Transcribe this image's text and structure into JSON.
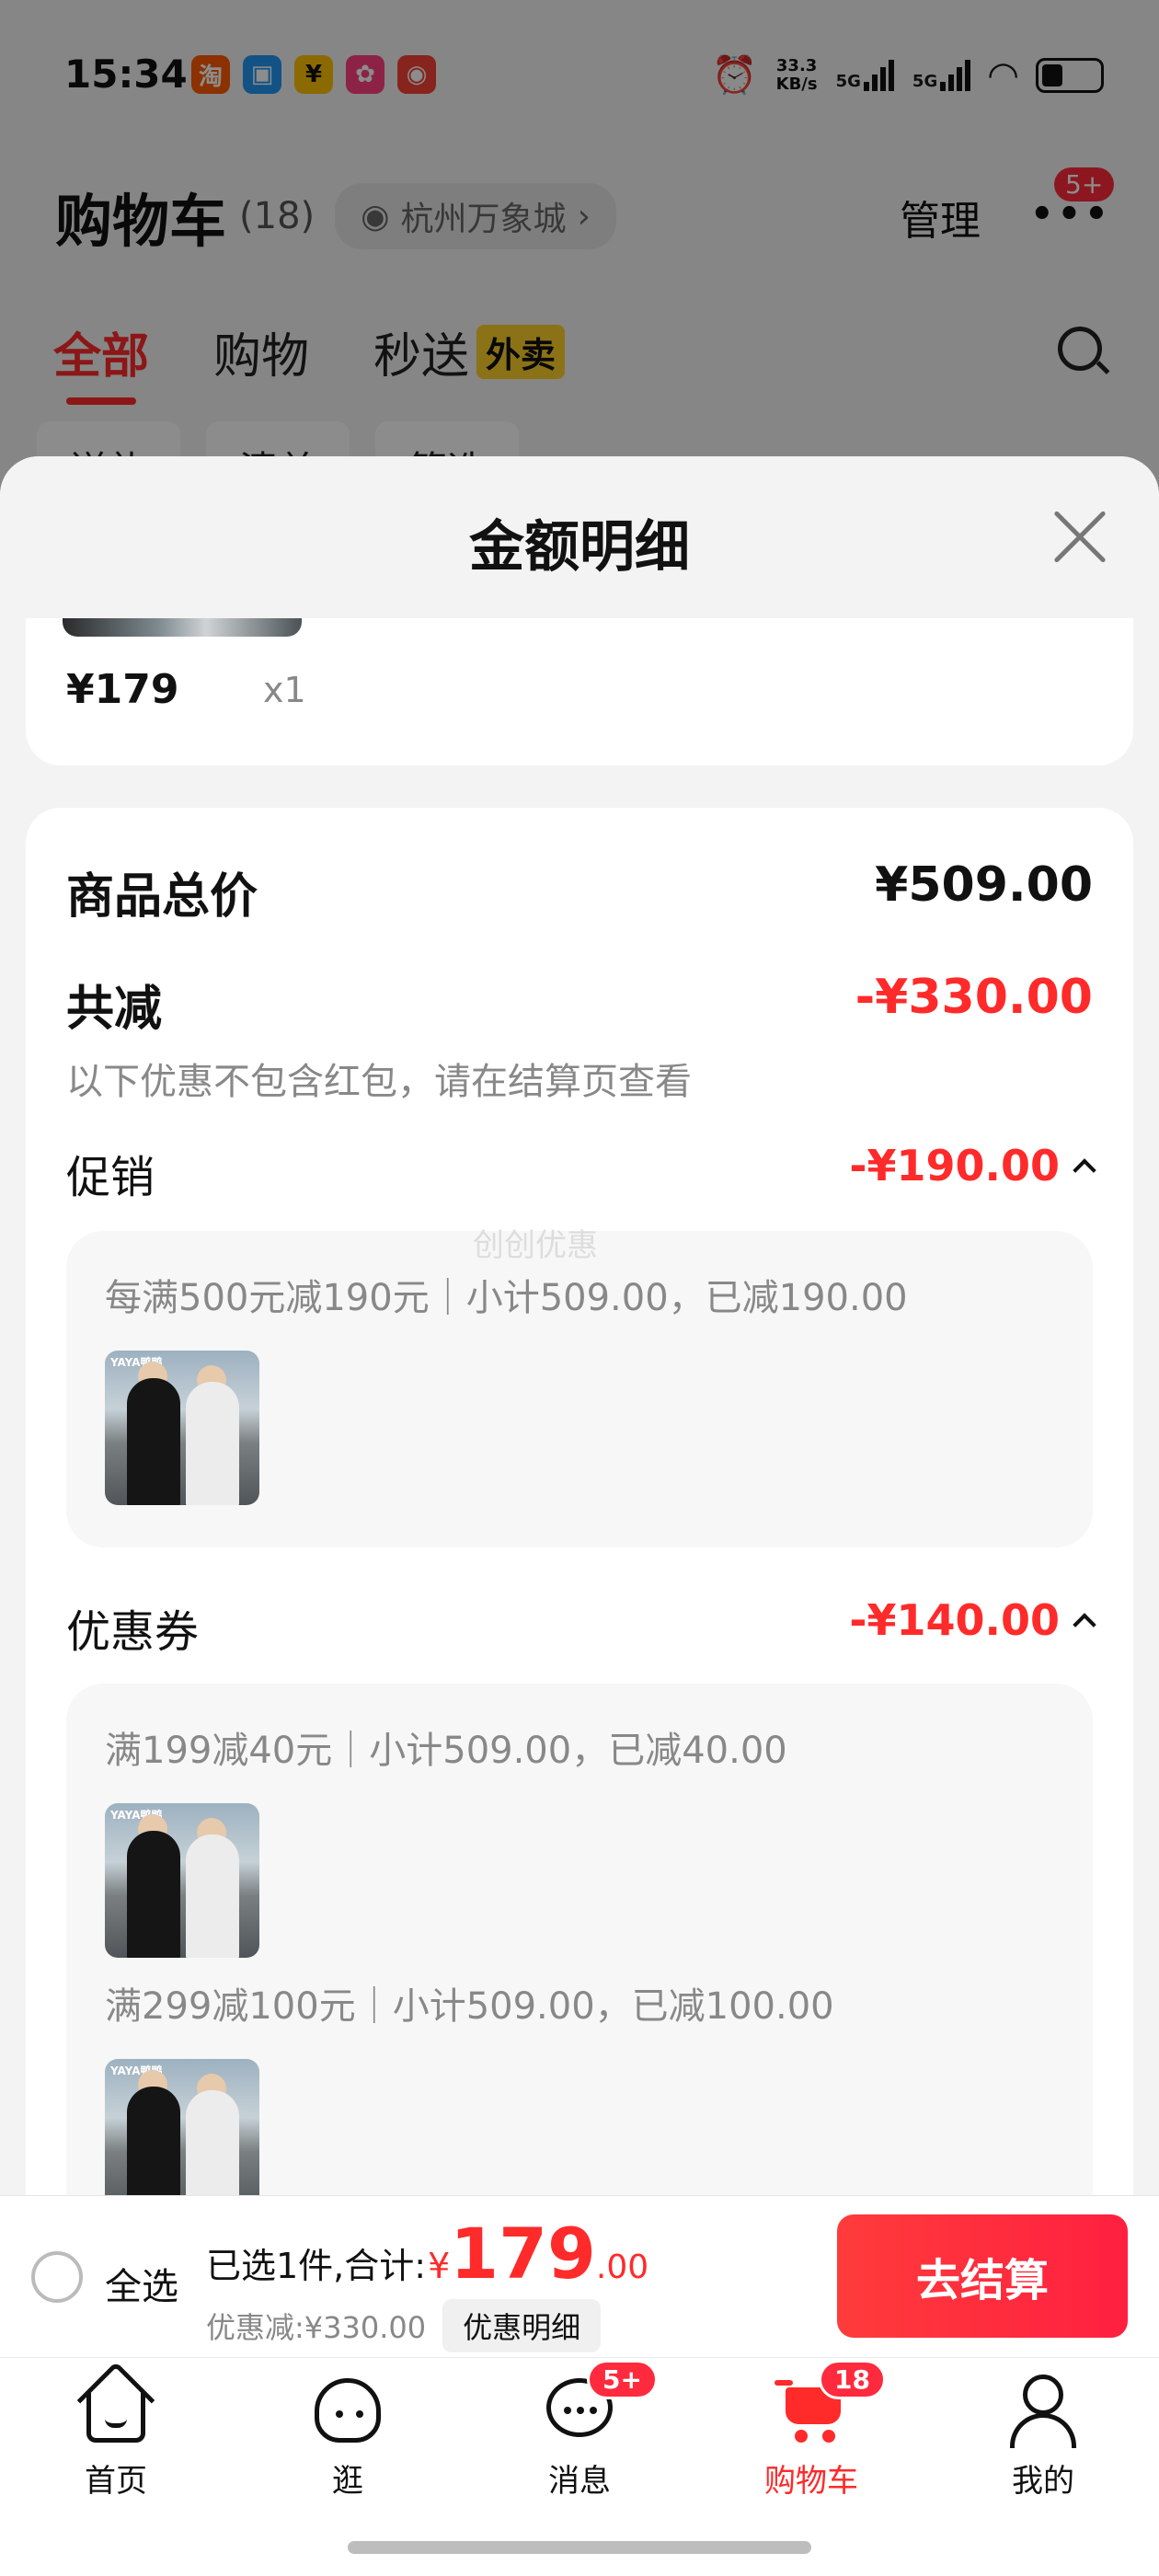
{
  "status_bar": {
    "time": "15:34",
    "apps": [
      {
        "glyph": "淘",
        "color": "#ff5a00"
      },
      {
        "glyph": "▣",
        "color": "#2196f3"
      },
      {
        "glyph": "¥",
        "color": "#ffc107"
      },
      {
        "glyph": "✿",
        "color": "#ff4081"
      },
      {
        "glyph": "◉",
        "color": "#f44336"
      }
    ],
    "net_speed_value": "33.3",
    "net_speed_unit": "KB/s",
    "signal1": "5G",
    "signal2": "5G"
  },
  "background_page": {
    "title": "购物车",
    "count": "(18)",
    "location": "杭州万象城",
    "manage": "管理",
    "more_badge": "5+",
    "tabs": [
      {
        "label": "全部",
        "active": true
      },
      {
        "label": "购物",
        "active": false
      },
      {
        "label": "秒送",
        "active": false,
        "tag": "外卖"
      }
    ],
    "chips": [
      "送礼",
      "清单",
      "筛选"
    ]
  },
  "sheet": {
    "title": "金额明细",
    "prev_item": {
      "price": "¥179",
      "qty": "x1"
    },
    "total": {
      "label": "商品总价",
      "value": "¥509.00"
    },
    "discount_total": {
      "label": "共减",
      "value": "-¥330.00",
      "note": "以下优惠不包含红包，请在结算页查看"
    },
    "promotion": {
      "label": "促销",
      "value": "-¥190.00",
      "lines": [
        "每满500元减190元｜小计509.00，已减190.00"
      ]
    },
    "coupon": {
      "label": "优惠券",
      "value": "-¥140.00",
      "lines": [
        "满199减40元｜小计509.00，已减40.00",
        "满299减100元｜小计509.00，已减100.00"
      ]
    },
    "watermark": "创创优惠",
    "thumb_logo": "YAYA鸭鸭"
  },
  "checkout": {
    "select_all": "全选",
    "summary_label": "已选1件,合计:",
    "currency": "¥",
    "total_int": "179",
    "total_dec": ".00",
    "discount_text": "优惠减:¥330.00",
    "detail_button": "优惠明细",
    "pay_button": "去结算"
  },
  "tabbar": {
    "items": [
      {
        "label": "首页",
        "icon": "home-icon"
      },
      {
        "label": "逛",
        "icon": "discover-icon"
      },
      {
        "label": "消息",
        "icon": "message-icon",
        "badge": "5+"
      },
      {
        "label": "购物车",
        "icon": "cart-icon",
        "badge": "18",
        "active": true
      },
      {
        "label": "我的",
        "icon": "profile-icon"
      }
    ]
  },
  "colors": {
    "accent": "#ff2a2a",
    "badge": "#ff2a3d",
    "tag_yellow": "#ffd02a"
  }
}
